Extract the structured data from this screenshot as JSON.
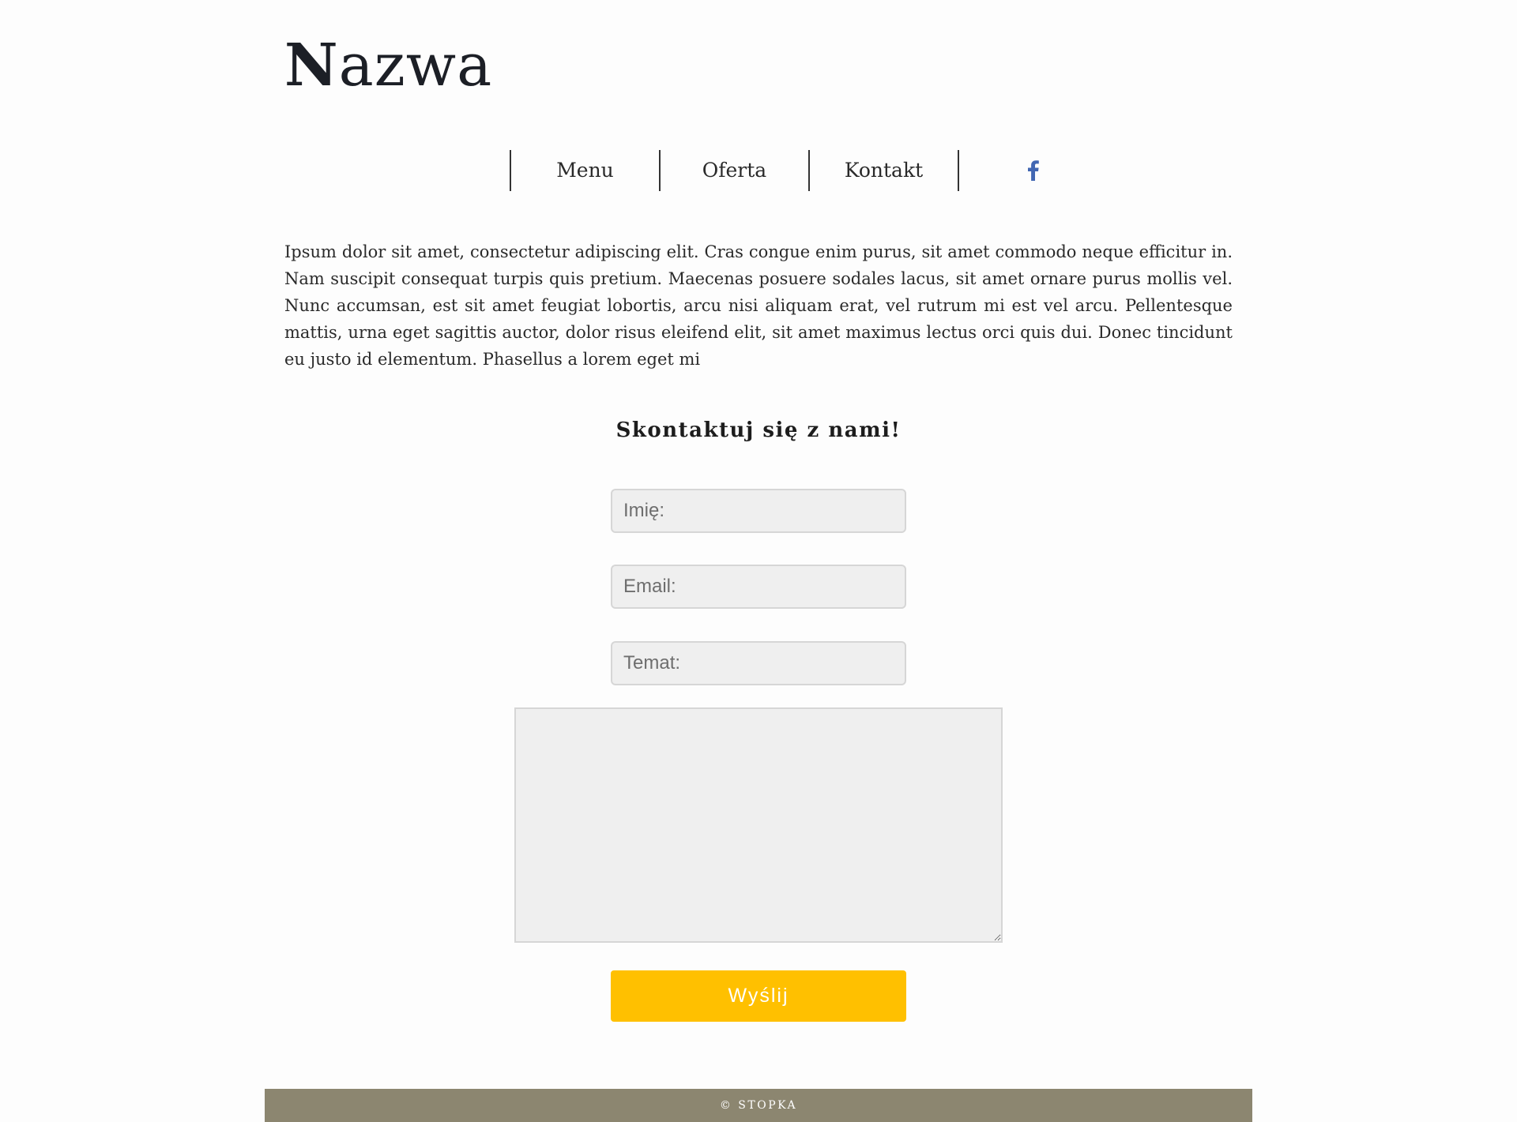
{
  "header": {
    "brand_first": "N",
    "brand_rest": "azwa"
  },
  "nav": {
    "items": [
      {
        "label": "Menu"
      },
      {
        "label": "Oferta"
      },
      {
        "label": "Kontakt"
      }
    ],
    "social_icon": "facebook-icon",
    "social_color": "#4267b2"
  },
  "intro": {
    "text": "Ipsum dolor sit amet, consectetur adipiscing elit. Cras congue enim purus, sit amet commodo neque efficitur in. Nam suscipit consequat turpis quis pretium. Maecenas posuere sodales lacus, sit amet ornare purus mollis vel. Nunc accumsan, est sit amet feugiat lobortis, arcu nisi aliquam erat, vel rutrum mi est vel arcu. Pellentesque mattis, urna eget sagittis auctor, dolor risus eleifend elit, sit amet maximus lectus orci quis dui. Donec tincidunt eu justo id elementum. Phasellus a lorem eget mi"
  },
  "contact": {
    "title": "Skontaktuj się z nami!",
    "name_placeholder": "Imię:",
    "email_placeholder": "Email:",
    "subject_placeholder": "Temat:",
    "message_value": "",
    "submit_label": "Wyślij",
    "submit_color": "#ffc000"
  },
  "footer": {
    "text": "© STOPKA",
    "background": "#8c8670"
  }
}
